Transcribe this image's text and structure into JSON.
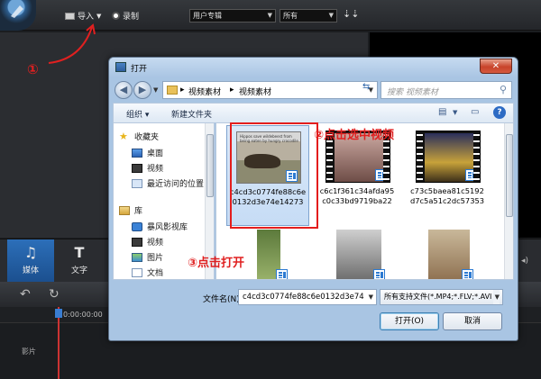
{
  "app": {
    "toolbar": {
      "import_label": "导入",
      "record_label": "录制",
      "album_select": "用户专辑",
      "filter_select": "所有"
    },
    "tabs": [
      {
        "label": "媒体",
        "icon": "music-media-icon"
      },
      {
        "label": "文字",
        "icon": "text-icon"
      }
    ],
    "timeline": {
      "time": "0:00:00:00",
      "track_label": "影片"
    }
  },
  "annotations": {
    "step1": "①",
    "step2": "②点击选中视频",
    "step3": "③点击打开"
  },
  "dialog": {
    "title": "打开",
    "address": [
      "视频素材",
      "视频素材"
    ],
    "search_placeholder": "搜索 视频素材",
    "commands": {
      "organize": "组织 ▾",
      "new_folder": "新建文件夹"
    },
    "nav": {
      "favorites": "收藏夹",
      "favorites_items": [
        "桌面",
        "视频",
        "最近访问的位置"
      ],
      "libraries": "库",
      "library_items": [
        "暴风影视库",
        "视频",
        "图片",
        "文档"
      ]
    },
    "files": [
      {
        "name": "c4cd3c0774fe88c6e0132d3e74e14273",
        "selected": true,
        "thumb_caption": "Hippos save wildebeest from being eaten by hungry crocodile"
      },
      {
        "name": "c6c1f361c34afda95c0c33bd9719ba22",
        "selected": false
      },
      {
        "name": "c73c5baea81c5192d7c5a51c2dc57353",
        "selected": false
      },
      {
        "name": "",
        "selected": false
      },
      {
        "name": "",
        "selected": false
      },
      {
        "name": "",
        "selected": false
      }
    ],
    "filename_label": "文件名(N):",
    "filename_value": "c4cd3c0774fe88c6e0132d3e74",
    "filetype_value": "所有支持文件(*.MP4;*.FLV;*.AVI",
    "open_button": "打开(O)",
    "cancel_button": "取消"
  },
  "colors": {
    "annotation_red": "#e02020",
    "active_tab_blue": "#2c6fb9",
    "dialog_frame": "#a9c5e3"
  }
}
